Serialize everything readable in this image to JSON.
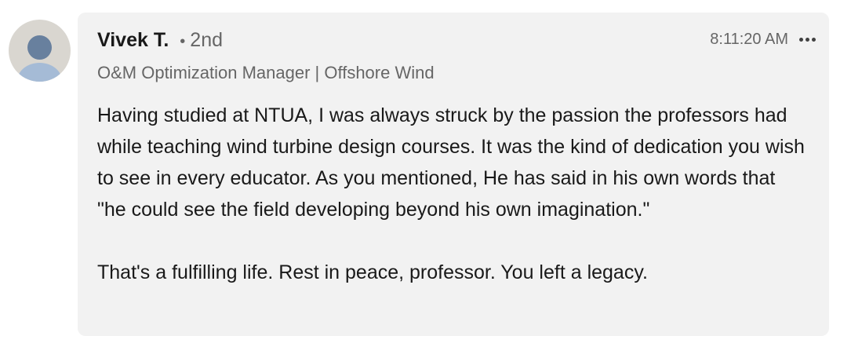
{
  "author": {
    "name": "Vivek T.",
    "separator": "•",
    "degree": "2nd",
    "headline": "O&M Optimization Manager | Offshore Wind",
    "avatar_icon": "default-person-icon"
  },
  "meta": {
    "timestamp": "8:11:20 AM",
    "more_icon": "ellipsis-icon"
  },
  "comment": {
    "paragraph_1": "Having studied at NTUA, I was always struck by the passion the professors had while teaching wind turbine design courses. It was the kind of dedication you wish to see in every educator. As you mentioned, He has said in his own words that \"he could see the field developing beyond his own imagination.\"",
    "paragraph_2": "That's a fulfilling life. Rest in peace, professor. You left a legacy."
  },
  "colors": {
    "bubble_background": "#f2f2f2",
    "primary_text": "#191919",
    "secondary_text": "#666666",
    "avatar_head": "#68809e",
    "avatar_body": "#a5bbd6",
    "avatar_background": "#d9d6d0"
  }
}
